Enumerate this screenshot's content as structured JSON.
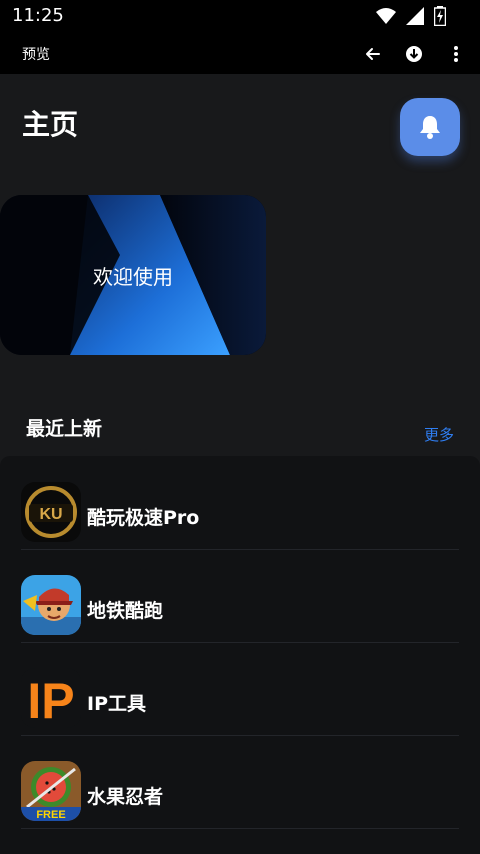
{
  "status_bar": {
    "time": "11:25"
  },
  "top_bar": {
    "title": "预览"
  },
  "page": {
    "title": "主页"
  },
  "banner": {
    "text": "欢迎使用"
  },
  "section": {
    "title": "最近上新",
    "more_label": "更多"
  },
  "apps": [
    {
      "name": "酷玩极速Pro",
      "icon": "ku-logo-icon",
      "icon_text": "KU"
    },
    {
      "name": "地铁酷跑",
      "icon": "subway-surfers-icon"
    },
    {
      "name": "IP工具",
      "icon": "ip-logo-icon",
      "icon_text": "IP"
    },
    {
      "name": "水果忍者",
      "icon": "fruit-ninja-icon",
      "icon_text": "FREE"
    }
  ],
  "colors": {
    "accent": "#5b8de8",
    "link": "#2f7ef2",
    "background": "#18191b",
    "panel": "#111214"
  }
}
